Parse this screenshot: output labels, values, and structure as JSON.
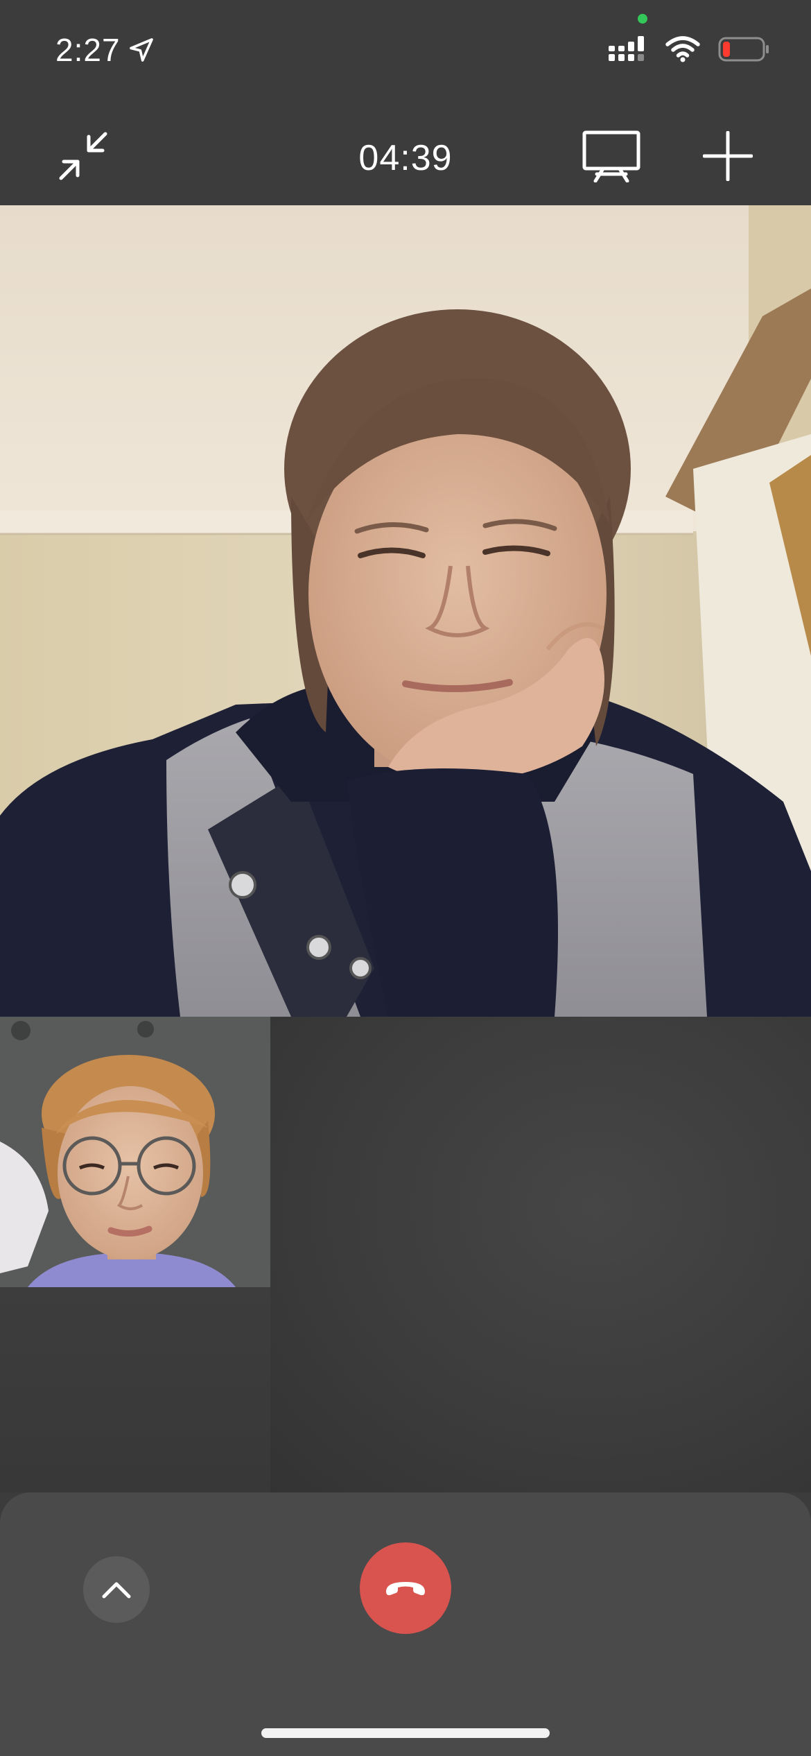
{
  "status_bar": {
    "time": "2:27",
    "location_icon": "location-arrow-icon",
    "cellular_icon": "cellular-signal-icon",
    "wifi_icon": "wifi-icon",
    "battery_icon": "battery-low-icon",
    "battery_level": 0.1,
    "privacy_indicator_color": "#34c759"
  },
  "call_header": {
    "duration": "04:39",
    "minimize_icon": "minimize-arrows-icon",
    "screen_share_icon": "screen-share-icon",
    "add_participant_icon": "plus-icon"
  },
  "videos": {
    "remote": "remote-participant-video",
    "self": "self-preview-video"
  },
  "controls": {
    "expand_icon": "chevron-up-icon",
    "end_call_icon": "phone-hangup-icon",
    "end_call_color": "#d9534f"
  },
  "colors": {
    "background": "#3c3c3c",
    "panel": "#4a4a4a",
    "text": "#ffffff",
    "battery_red": "#ff3b30"
  }
}
